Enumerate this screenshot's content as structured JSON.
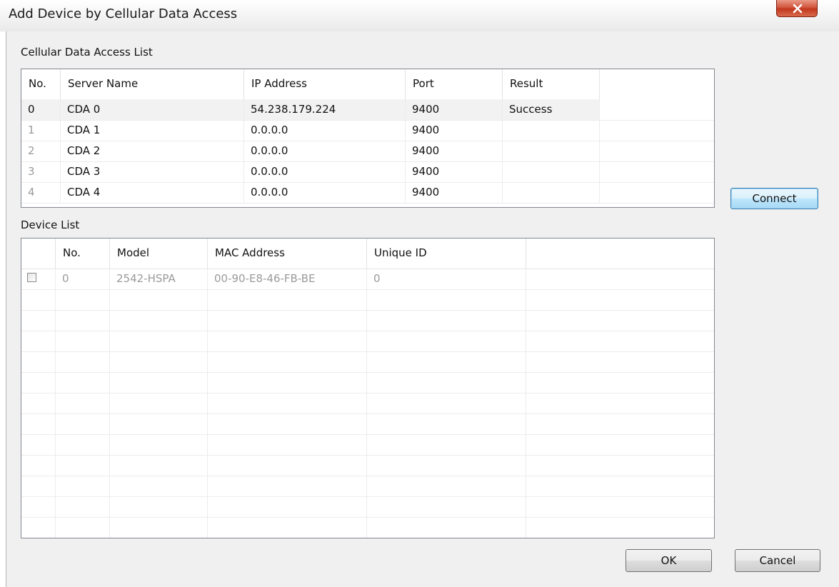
{
  "window": {
    "title": "Add Device by Cellular Data Access",
    "close_glyph": "X"
  },
  "cda_section": {
    "label": "Cellular Data Access List",
    "columns": [
      "No.",
      "Server Name",
      "IP Address",
      "Port",
      "Result"
    ],
    "rows": [
      {
        "no": "0",
        "server": "CDA 0",
        "ip": "54.238.179.224",
        "port": "9400",
        "result": "Success"
      },
      {
        "no": "1",
        "server": "CDA 1",
        "ip": "0.0.0.0",
        "port": "9400",
        "result": ""
      },
      {
        "no": "2",
        "server": "CDA 2",
        "ip": "0.0.0.0",
        "port": "9400",
        "result": ""
      },
      {
        "no": "3",
        "server": "CDA 3",
        "ip": "0.0.0.0",
        "port": "9400",
        "result": ""
      },
      {
        "no": "4",
        "server": "CDA 4",
        "ip": "0.0.0.0",
        "port": "9400",
        "result": ""
      }
    ]
  },
  "device_section": {
    "label": "Device List",
    "columns": [
      "",
      "No.",
      "Model",
      "MAC Address",
      "Unique ID"
    ],
    "rows": [
      {
        "checked": false,
        "no": "0",
        "model": "2542-HSPA",
        "mac": "00-90-E8-46-FB-BE",
        "unique_id": "0"
      }
    ]
  },
  "buttons": {
    "connect": "Connect",
    "ok": "OK",
    "cancel": "Cancel"
  }
}
